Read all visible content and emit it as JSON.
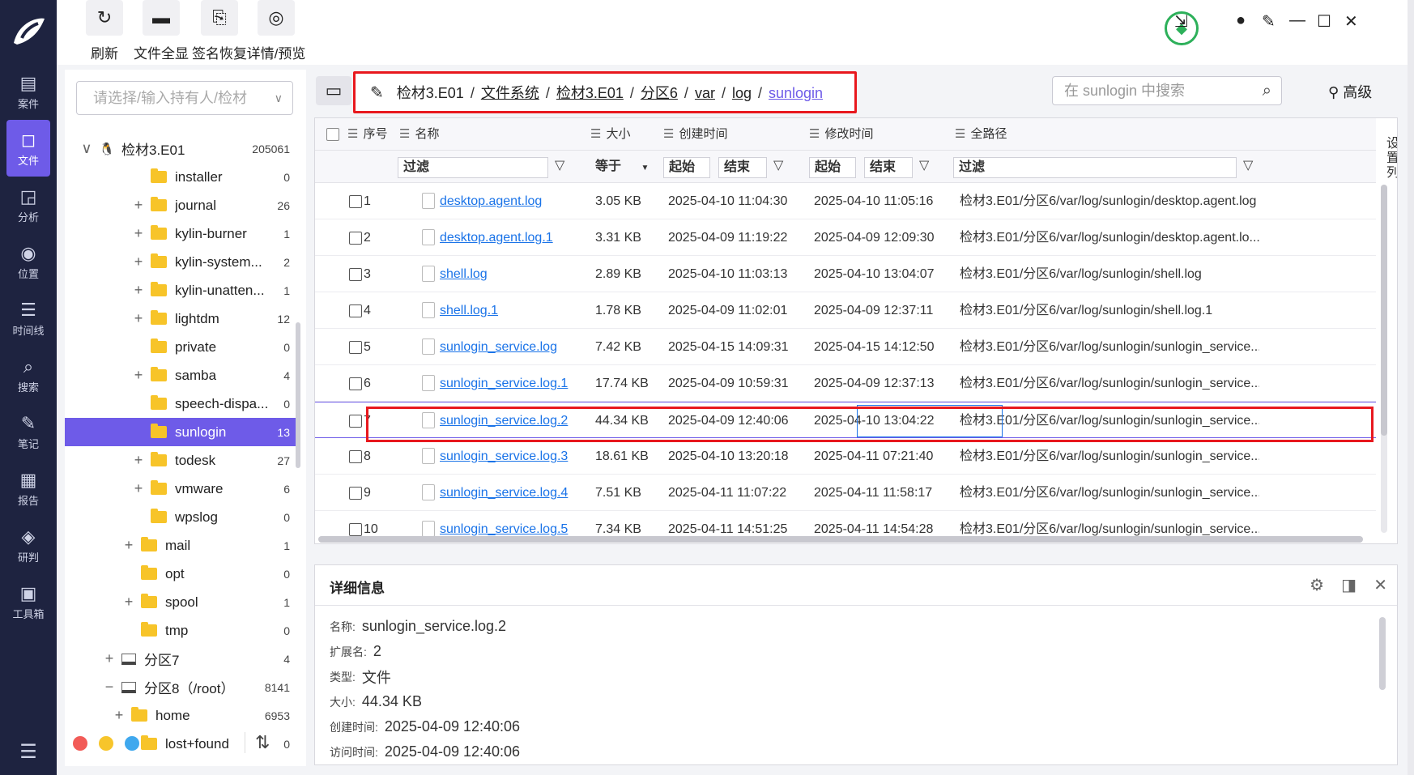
{
  "nav": {
    "items": [
      {
        "label": "案件",
        "icon": "case-icon",
        "glyph": "▤"
      },
      {
        "label": "文件",
        "icon": "file-icon",
        "glyph": "◻"
      },
      {
        "label": "分析",
        "icon": "analysis-icon",
        "glyph": "◲"
      },
      {
        "label": "位置",
        "icon": "location-icon",
        "glyph": "◉"
      },
      {
        "label": "时间线",
        "icon": "timeline-icon",
        "glyph": "☰"
      },
      {
        "label": "搜索",
        "icon": "search-icon",
        "glyph": "⌕"
      },
      {
        "label": "笔记",
        "icon": "note-icon",
        "glyph": "✎"
      },
      {
        "label": "报告",
        "icon": "report-icon",
        "glyph": "▦"
      },
      {
        "label": "研判",
        "icon": "judge-icon",
        "glyph": "◈"
      },
      {
        "label": "工具箱",
        "icon": "toolbox-icon",
        "glyph": "▣"
      }
    ],
    "active_index": 1
  },
  "toolbar": {
    "buttons": [
      {
        "label": "刷新",
        "icon": "refresh-icon",
        "glyph": "↻"
      },
      {
        "label": "文件全显",
        "icon": "folder-icon",
        "glyph": "▬"
      },
      {
        "label": "签名恢复",
        "icon": "signature-restore-icon",
        "glyph": "⎘"
      },
      {
        "label": "详情/预览",
        "icon": "eye-off-icon",
        "glyph": "◎"
      }
    ]
  },
  "tree": {
    "owner_placeholder": "请选择/输入持有人/检材",
    "rows": [
      {
        "label": "检材3.E01",
        "count": "205061",
        "indent": 20,
        "exp": "∨",
        "kind": "tux"
      },
      {
        "label": "installer",
        "count": "0",
        "indent": 84,
        "exp": "",
        "kind": "folder"
      },
      {
        "label": "journal",
        "count": "26",
        "indent": 84,
        "exp": "+",
        "kind": "folder"
      },
      {
        "label": "kylin-burner",
        "count": "1",
        "indent": 84,
        "exp": "+",
        "kind": "folder"
      },
      {
        "label": "kylin-system...",
        "count": "2",
        "indent": 84,
        "exp": "+",
        "kind": "folder"
      },
      {
        "label": "kylin-unatten...",
        "count": "1",
        "indent": 84,
        "exp": "+",
        "kind": "folder"
      },
      {
        "label": "lightdm",
        "count": "12",
        "indent": 84,
        "exp": "+",
        "kind": "folder"
      },
      {
        "label": "private",
        "count": "0",
        "indent": 84,
        "exp": "",
        "kind": "folder"
      },
      {
        "label": "samba",
        "count": "4",
        "indent": 84,
        "exp": "+",
        "kind": "folder"
      },
      {
        "label": "speech-dispa...",
        "count": "0",
        "indent": 84,
        "exp": "",
        "kind": "folder"
      },
      {
        "label": "sunlogin",
        "count": "13",
        "indent": 84,
        "exp": "",
        "kind": "folder",
        "selected": true
      },
      {
        "label": "todesk",
        "count": "27",
        "indent": 84,
        "exp": "+",
        "kind": "folder"
      },
      {
        "label": "vmware",
        "count": "6",
        "indent": 84,
        "exp": "+",
        "kind": "folder"
      },
      {
        "label": "wpslog",
        "count": "0",
        "indent": 84,
        "exp": "",
        "kind": "folder"
      },
      {
        "label": "mail",
        "count": "1",
        "indent": 72,
        "exp": "+",
        "kind": "folder"
      },
      {
        "label": "opt",
        "count": "0",
        "indent": 72,
        "exp": "",
        "kind": "folder"
      },
      {
        "label": "spool",
        "count": "1",
        "indent": 72,
        "exp": "+",
        "kind": "folder"
      },
      {
        "label": "tmp",
        "count": "0",
        "indent": 72,
        "exp": "",
        "kind": "folder"
      },
      {
        "label": "分区7",
        "count": "4",
        "indent": 48,
        "exp": "+",
        "kind": "disk"
      },
      {
        "label": "分区8（/root）",
        "count": "8141",
        "indent": 48,
        "exp": "−",
        "kind": "disk"
      },
      {
        "label": "home",
        "count": "6953",
        "indent": 60,
        "exp": "+",
        "kind": "folder"
      },
      {
        "label": "lost+found",
        "count": "0",
        "indent": 72,
        "exp": "",
        "kind": "folder"
      }
    ]
  },
  "breadcrumb": {
    "segments": [
      "检材3.E01",
      "文件系统",
      "检材3.E01",
      "分区6",
      "var",
      "log",
      "sunlogin"
    ]
  },
  "search": {
    "placeholder": "在 sunlogin 中搜索"
  },
  "advanced_label": "高级",
  "grid": {
    "headers": {
      "seq": "序号",
      "name": "名称",
      "size": "大小",
      "created": "创建时间",
      "modified": "修改时间",
      "path": "全路径"
    },
    "filters": {
      "filter": "过滤",
      "equals": "等于",
      "start": "起始",
      "end": "结束"
    },
    "settings_label": "设置列",
    "rows": [
      {
        "seq": "1",
        "name": "desktop.agent.log",
        "size": "3.05 KB",
        "created": "2025-04-10 11:04:30",
        "modified": "2025-04-10 11:05:16",
        "path": "检材3.E01/分区6/var/log/sunlogin/desktop.agent.log"
      },
      {
        "seq": "2",
        "name": "desktop.agent.log.1",
        "size": "3.31 KB",
        "created": "2025-04-09 11:19:22",
        "modified": "2025-04-09 12:09:30",
        "path": "检材3.E01/分区6/var/log/sunlogin/desktop.agent.lo..."
      },
      {
        "seq": "3",
        "name": "shell.log",
        "size": "2.89 KB",
        "created": "2025-04-10 11:03:13",
        "modified": "2025-04-10 13:04:07",
        "path": "检材3.E01/分区6/var/log/sunlogin/shell.log"
      },
      {
        "seq": "4",
        "name": "shell.log.1",
        "size": "1.78 KB",
        "created": "2025-04-09 11:02:01",
        "modified": "2025-04-09 12:37:11",
        "path": "检材3.E01/分区6/var/log/sunlogin/shell.log.1"
      },
      {
        "seq": "5",
        "name": "sunlogin_service.log",
        "size": "7.42 KB",
        "created": "2025-04-15 14:09:31",
        "modified": "2025-04-15 14:12:50",
        "path": "检材3.E01/分区6/var/log/sunlogin/sunlogin_service..."
      },
      {
        "seq": "6",
        "name": "sunlogin_service.log.1",
        "size": "17.74 KB",
        "created": "2025-04-09 10:59:31",
        "modified": "2025-04-09 12:37:13",
        "path": "检材3.E01/分区6/var/log/sunlogin/sunlogin_service..."
      },
      {
        "seq": "7",
        "name": "sunlogin_service.log.2",
        "size": "44.34 KB",
        "created": "2025-04-09 12:40:06",
        "modified": "2025-04-10 13:04:22",
        "path": "检材3.E01/分区6/var/log/sunlogin/sunlogin_service...",
        "selected": true
      },
      {
        "seq": "8",
        "name": "sunlogin_service.log.3",
        "size": "18.61 KB",
        "created": "2025-04-10 13:20:18",
        "modified": "2025-04-11 07:21:40",
        "path": "检材3.E01/分区6/var/log/sunlogin/sunlogin_service..."
      },
      {
        "seq": "9",
        "name": "sunlogin_service.log.4",
        "size": "7.51 KB",
        "created": "2025-04-11 11:07:22",
        "modified": "2025-04-11 11:58:17",
        "path": "检材3.E01/分区6/var/log/sunlogin/sunlogin_service..."
      },
      {
        "seq": "10",
        "name": "sunlogin_service.log.5",
        "size": "7.34 KB",
        "created": "2025-04-11 14:51:25",
        "modified": "2025-04-11 14:54:28",
        "path": "检材3.E01/分区6/var/log/sunlogin/sunlogin_service..."
      }
    ]
  },
  "detail": {
    "title": "详细信息",
    "fields": [
      {
        "label": "名称:",
        "value": "sunlogin_service.log.2"
      },
      {
        "label": "扩展名:",
        "value": "2"
      },
      {
        "label": "类型:",
        "value": "文件"
      },
      {
        "label": "大小:",
        "value": "44.34 KB"
      },
      {
        "label": "创建时间:",
        "value": "2025-04-09 12:40:06"
      },
      {
        "label": "访问时间:",
        "value": "2025-04-09 12:40:06"
      }
    ]
  },
  "colors": {
    "accent": "#6e5be8",
    "nav_bg": "#1e2340",
    "highlight": "#e8181e",
    "link": "#1a73e8",
    "dots": [
      "#f25b57",
      "#f7c52b",
      "#3fa8ee"
    ]
  }
}
